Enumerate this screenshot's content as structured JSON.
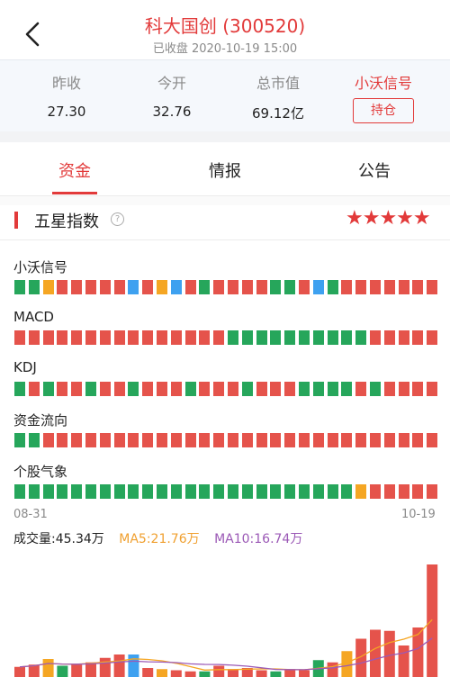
{
  "header": {
    "title": "科大国创 (300520)",
    "subtitle": "已收盘 2020-10-19 15:00"
  },
  "quote": {
    "prev_close_label": "昨收",
    "prev_close": "27.30",
    "open_label": "今开",
    "open": "32.76",
    "mktcap_label": "总市值",
    "mktcap": "69.12亿",
    "signal_label": "小沃信号",
    "hold_button": "持仓"
  },
  "tabs": [
    "资金",
    "情报",
    "公告"
  ],
  "section": {
    "title": "五星指数",
    "stars": "★★★★★"
  },
  "colors": {
    "red": "#e5534b",
    "green": "#26a65b",
    "orange": "#f5a623",
    "blue": "#3ea1f0",
    "accent": "#e23a3a"
  },
  "indicators": [
    {
      "label": "小沃信号",
      "blocks": [
        "g",
        "g",
        "o",
        "r",
        "r",
        "r",
        "r",
        "r",
        "b",
        "r",
        "o",
        "b",
        "r",
        "g",
        "r",
        "r",
        "r",
        "r",
        "g",
        "g",
        "r",
        "b",
        "g",
        "r",
        "r",
        "r",
        "r",
        "r",
        "r",
        "r"
      ]
    },
    {
      "label": "MACD",
      "blocks": [
        "r",
        "r",
        "r",
        "r",
        "r",
        "r",
        "r",
        "r",
        "r",
        "r",
        "r",
        "r",
        "r",
        "r",
        "r",
        "g",
        "g",
        "g",
        "g",
        "g",
        "g",
        "g",
        "g",
        "g",
        "g",
        "r",
        "r",
        "r",
        "r",
        "r"
      ]
    },
    {
      "label": "KDJ",
      "blocks": [
        "g",
        "r",
        "g",
        "r",
        "r",
        "g",
        "r",
        "r",
        "g",
        "r",
        "r",
        "r",
        "g",
        "r",
        "r",
        "r",
        "g",
        "r",
        "r",
        "r",
        "g",
        "g",
        "g",
        "g",
        "r",
        "g",
        "r",
        "r",
        "r",
        "r"
      ]
    },
    {
      "label": "资金流向",
      "blocks": [
        "g",
        "g",
        "r",
        "r",
        "r",
        "r",
        "r",
        "r",
        "r",
        "r",
        "r",
        "r",
        "r",
        "r",
        "r",
        "r",
        "r",
        "r",
        "r",
        "r",
        "r",
        "r",
        "r",
        "r",
        "r",
        "r",
        "r",
        "r",
        "r",
        "r"
      ]
    },
    {
      "label": "个股气象",
      "blocks": [
        "g",
        "g",
        "g",
        "g",
        "g",
        "g",
        "g",
        "g",
        "g",
        "g",
        "g",
        "g",
        "g",
        "g",
        "g",
        "g",
        "g",
        "g",
        "g",
        "g",
        "g",
        "g",
        "g",
        "g",
        "o",
        "r",
        "r",
        "r",
        "r",
        "r"
      ]
    }
  ],
  "dates": {
    "start": "08-31",
    "end": "10-19"
  },
  "volume": {
    "main": "成交量:45.34万",
    "ma5": "MA5:21.76万",
    "ma10": "MA10:16.74万",
    "bars": [
      {
        "v": 0.09,
        "c": "r"
      },
      {
        "v": 0.11,
        "c": "r"
      },
      {
        "v": 0.16,
        "c": "o"
      },
      {
        "v": 0.1,
        "c": "g"
      },
      {
        "v": 0.11,
        "c": "r"
      },
      {
        "v": 0.13,
        "c": "r"
      },
      {
        "v": 0.17,
        "c": "r"
      },
      {
        "v": 0.2,
        "c": "r"
      },
      {
        "v": 0.2,
        "c": "b"
      },
      {
        "v": 0.08,
        "c": "r"
      },
      {
        "v": 0.07,
        "c": "o"
      },
      {
        "v": 0.06,
        "c": "r"
      },
      {
        "v": 0.05,
        "c": "r"
      },
      {
        "v": 0.05,
        "c": "g"
      },
      {
        "v": 0.1,
        "c": "r"
      },
      {
        "v": 0.07,
        "c": "r"
      },
      {
        "v": 0.08,
        "c": "r"
      },
      {
        "v": 0.06,
        "c": "r"
      },
      {
        "v": 0.05,
        "c": "g"
      },
      {
        "v": 0.07,
        "c": "r"
      },
      {
        "v": 0.06,
        "c": "r"
      },
      {
        "v": 0.15,
        "c": "g"
      },
      {
        "v": 0.13,
        "c": "r"
      },
      {
        "v": 0.23,
        "c": "o"
      },
      {
        "v": 0.34,
        "c": "r"
      },
      {
        "v": 0.42,
        "c": "r"
      },
      {
        "v": 0.41,
        "c": "r"
      },
      {
        "v": 0.28,
        "c": "r"
      },
      {
        "v": 0.44,
        "c": "r"
      },
      {
        "v": 1.0,
        "c": "r"
      }
    ]
  }
}
